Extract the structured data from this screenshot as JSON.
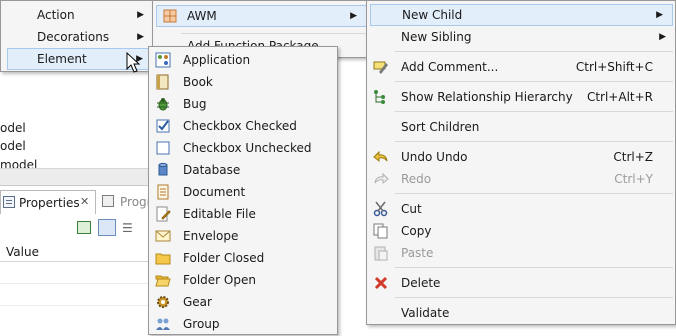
{
  "background": {
    "tree_rows": [
      "odel",
      "odel",
      "model"
    ],
    "properties_tab": "Properties",
    "other_tab": "Progr",
    "value_column": "Value"
  },
  "menu1": {
    "items": [
      {
        "label": "Action"
      },
      {
        "label": "Decorations"
      },
      {
        "label": "Element"
      }
    ]
  },
  "menu2": {
    "items": [
      {
        "label": "AWM"
      },
      {
        "label": "Add Function Package"
      }
    ]
  },
  "menu3": {
    "items": [
      {
        "label": "Application",
        "icon": "application-icon"
      },
      {
        "label": "Book",
        "icon": "book-icon"
      },
      {
        "label": "Bug",
        "icon": "bug-icon"
      },
      {
        "label": "Checkbox Checked",
        "icon": "checkbox-checked-icon"
      },
      {
        "label": "Checkbox Unchecked",
        "icon": "checkbox-unchecked-icon"
      },
      {
        "label": "Database",
        "icon": "database-icon"
      },
      {
        "label": "Document",
        "icon": "document-icon"
      },
      {
        "label": "Editable File",
        "icon": "editable-file-icon"
      },
      {
        "label": "Envelope",
        "icon": "envelope-icon"
      },
      {
        "label": "Folder Closed",
        "icon": "folder-closed-icon"
      },
      {
        "label": "Folder Open",
        "icon": "folder-open-icon"
      },
      {
        "label": "Gear",
        "icon": "gear-icon"
      },
      {
        "label": "Group",
        "icon": "group-icon"
      }
    ]
  },
  "menu4": {
    "new_child": "New Child",
    "new_sibling": "New Sibling",
    "add_comment": "Add Comment...",
    "add_comment_shortcut": "Ctrl+Shift+C",
    "show_relationship": "Show Relationship Hierarchy",
    "show_relationship_shortcut": "Ctrl+Alt+R",
    "sort_children": "Sort Children",
    "undo": "Undo Undo",
    "undo_shortcut": "Ctrl+Z",
    "redo": "Redo",
    "redo_shortcut": "Ctrl+Y",
    "cut": "Cut",
    "copy": "Copy",
    "paste": "Paste",
    "delete": "Delete",
    "validate": "Validate"
  },
  "colors": {
    "highlight": "#e3eefb",
    "menu_bg": "#f5f5f5",
    "disabled_text": "#9a9a9a"
  }
}
